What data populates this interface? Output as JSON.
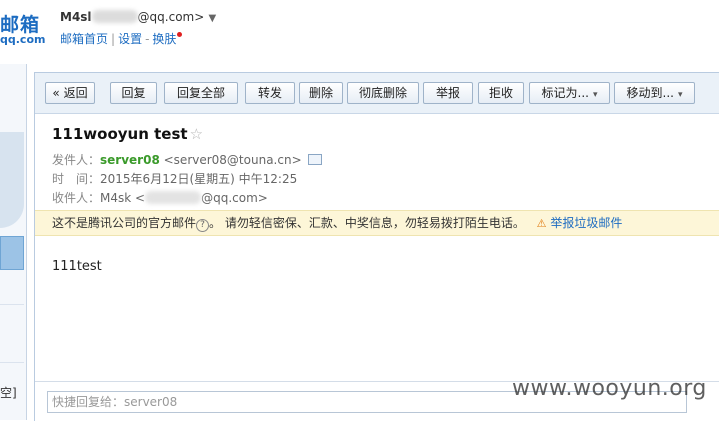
{
  "header": {
    "logo_title": "邮箱",
    "logo_sub": "qq.com",
    "account_prefix": "M4sl",
    "account_domain": "@qq.com>",
    "account_caret": "▼",
    "links": {
      "home": "邮箱首页",
      "settings": "设置",
      "skin": "换肤"
    }
  },
  "left": {
    "label": "空]"
  },
  "toolbar": {
    "back": "« 返回",
    "reply": "回复",
    "reply_all": "回复全部",
    "forward": "转发",
    "delete": "删除",
    "delete_permanently": "彻底删除",
    "report": "举报",
    "reject": "拒收",
    "mark_as": "标记为...",
    "move_to": "移动到...",
    "dropdown_arrow": "▾"
  },
  "mail": {
    "subject": "111wooyun test",
    "star": "☆",
    "from_label": "发件人：",
    "from_name": "server08",
    "from_addr": "<server08@touna.cn>",
    "time_label": "时　间：",
    "time_value": "2015年6月12日(星期五) 中午12:25",
    "to_label": "收件人：",
    "to_name": "M4sk",
    "to_addr_open": "<",
    "to_addr_tail": "@qq.com>",
    "body": "111test"
  },
  "warning": {
    "text": "这不是腾讯公司的官方邮件",
    "qmark": "?",
    "tip": "。  请勿轻信密保、汇款、中奖信息，勿轻易拨打陌生电话。",
    "report_icon": "⚠",
    "report": "举报垃圾邮件"
  },
  "quick_reply": {
    "placeholder": "快捷回复给：server08"
  },
  "watermark": "www.wooyun.org"
}
